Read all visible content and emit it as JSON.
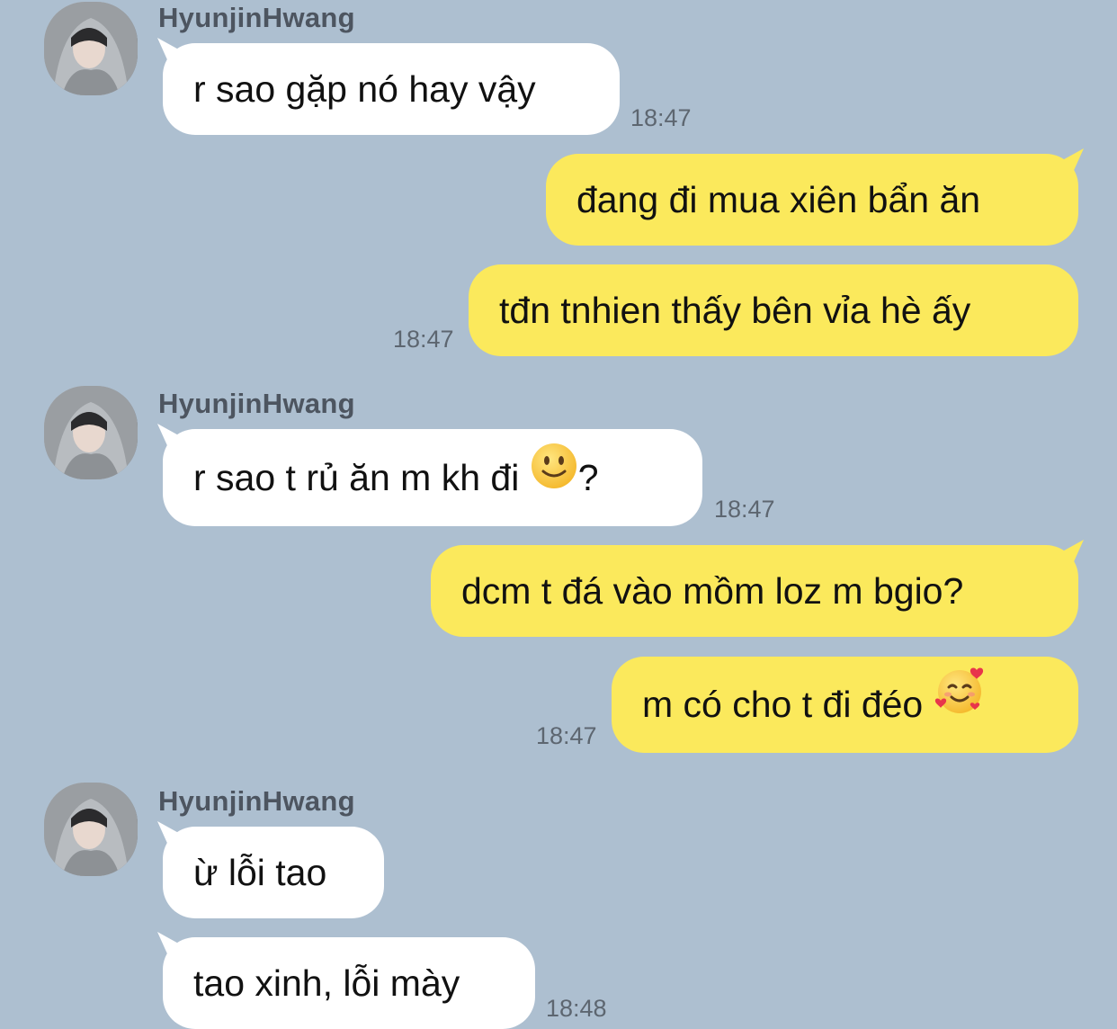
{
  "conversation": {
    "contact_name": "HyunjinHwang",
    "messages": [
      {
        "side": "in",
        "text": "r sao gặp nó hay vậy",
        "time": "18:47"
      },
      {
        "side": "out",
        "text": "đang đi mua xiên bẩn ăn",
        "time": ""
      },
      {
        "side": "out",
        "text": "tđn tnhien thấy bên vỉa hè ấy",
        "time": "18:47"
      },
      {
        "side": "in",
        "text": "r sao t rủ ăn m kh đi",
        "suffix": "?",
        "emoji": "slightly-smiling-face",
        "time": "18:47"
      },
      {
        "side": "out",
        "text": "dcm t đá vào mồm loz m bgio?",
        "time": ""
      },
      {
        "side": "out",
        "text": "m có cho t đi đéo",
        "emoji": "smiling-face-with-hearts",
        "time": "18:47"
      },
      {
        "side": "in",
        "text": "ừ lỗi tao",
        "time": ""
      },
      {
        "side": "in",
        "text": "tao xinh, lỗi mày",
        "time": "18:48"
      }
    ]
  },
  "colors": {
    "background": "#adbfd0",
    "incoming_bubble": "#ffffff",
    "outgoing_bubble": "#fbe95c",
    "sender_name": "#4d5560",
    "timestamp": "#5d6670"
  },
  "icons": [
    "avatar-photo",
    "slightly-smiling-face-icon",
    "smiling-face-with-hearts-icon"
  ]
}
